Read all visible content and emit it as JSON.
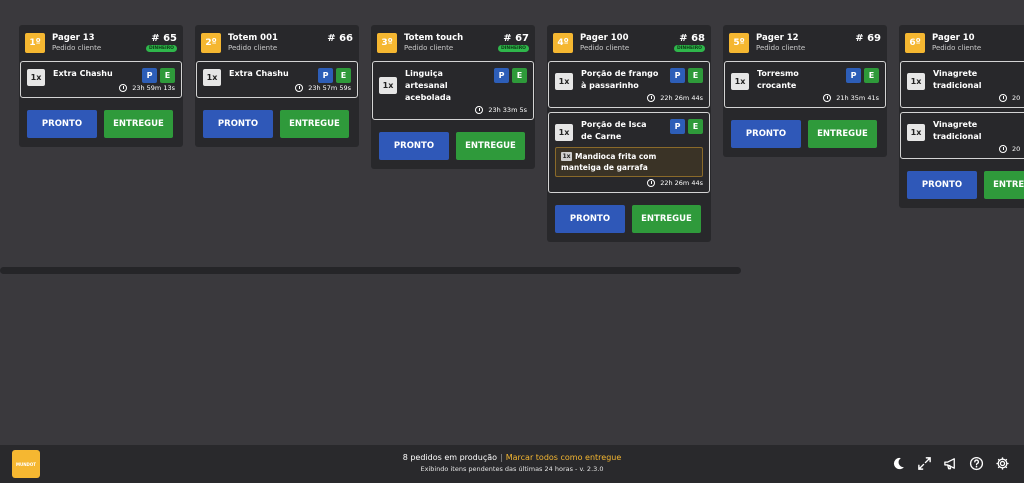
{
  "orders": [
    {
      "position": "1º",
      "name": "Pager 13",
      "type": "Pedido cliente",
      "number": "# 65",
      "payment": "DINHEIRO",
      "items": [
        {
          "qty": "1x",
          "name": "Extra Chashu",
          "tag_p": "P",
          "tag_e": "E",
          "time": "23h 59m 13s"
        }
      ],
      "pronto": "PRONTO",
      "entregue": "ENTREGUE"
    },
    {
      "position": "2º",
      "name": "Totem 001",
      "type": "Pedido cliente",
      "number": "# 66",
      "items": [
        {
          "qty": "1x",
          "name": "Extra Chashu",
          "tag_p": "P",
          "tag_e": "E",
          "time": "23h 57m 59s"
        }
      ],
      "pronto": "PRONTO",
      "entregue": "ENTREGUE"
    },
    {
      "position": "3º",
      "name": "Totem touch",
      "type": "Pedido cliente",
      "number": "# 67",
      "payment": "DINHEIRO",
      "items": [
        {
          "qty": "1x",
          "name": "Linguiça artesanal acebolada",
          "tag_p": "P",
          "tag_e": "E",
          "time": "23h 33m 5s"
        }
      ],
      "pronto": "PRONTO",
      "entregue": "ENTREGUE"
    },
    {
      "position": "4º",
      "name": "Pager 100",
      "type": "Pedido cliente",
      "number": "# 68",
      "payment": "DINHEIRO",
      "items": [
        {
          "qty": "1x",
          "name": "Porção de frango à passarinho",
          "tag_p": "P",
          "tag_e": "E",
          "time": "22h 26m 44s"
        },
        {
          "qty": "1x",
          "name": "Porção de Isca de Carne",
          "tag_p": "P",
          "tag_e": "E",
          "addon_qty": "1x",
          "addon": "Mandioca frita com manteiga de garrafa",
          "time": "22h 26m 44s"
        }
      ],
      "pronto": "PRONTO",
      "entregue": "ENTREGUE"
    },
    {
      "position": "5º",
      "name": "Pager 12",
      "type": "Pedido cliente",
      "number": "# 69",
      "items": [
        {
          "qty": "1x",
          "name": "Torresmo crocante",
          "tag_p": "P",
          "tag_e": "E",
          "time": "21h 35m 41s"
        }
      ],
      "pronto": "PRONTO",
      "entregue": "ENTREGUE"
    },
    {
      "position": "6º",
      "name": "Pager 10",
      "type": "Pedido cliente",
      "number": "",
      "items": [
        {
          "qty": "1x",
          "name": "Vinagrete tradicional",
          "tag_p": "P",
          "tag_e": "E",
          "time": "20"
        },
        {
          "qty": "1x",
          "name": "Vinagrete tradicional",
          "tag_p": "P",
          "tag_e": "E",
          "time": "20"
        }
      ],
      "pronto": "PRONTO",
      "entregue": "ENTREGUE"
    }
  ],
  "footer": {
    "logo": "MUNDOT",
    "status": "8 pedidos em produção",
    "separator": "|",
    "mark_all": "Marcar todos como entregue",
    "subtitle": "Exibindo itens pendentes das últimas 24 horas - v. 2.3.0",
    "icons": [
      "moon-icon",
      "fullscreen-icon",
      "megaphone-icon",
      "help-icon",
      "gear-icon"
    ]
  },
  "colors": {
    "accent": "#f5b731",
    "pronto": "#2f58b8",
    "entregue": "#2f9a3b",
    "background": "#3a393d",
    "card": "#28282b"
  }
}
